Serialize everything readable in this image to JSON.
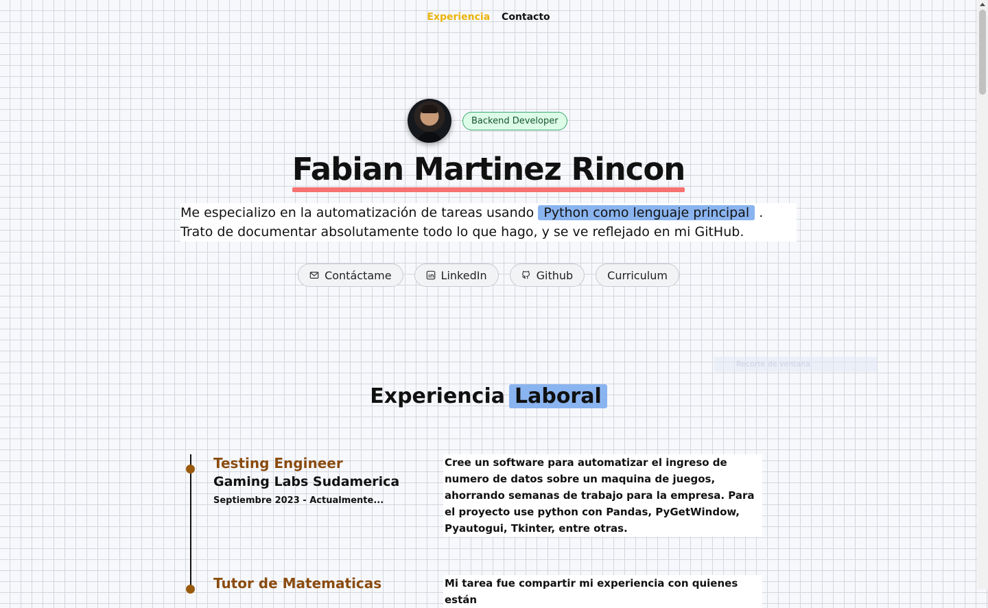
{
  "nav": {
    "items": [
      {
        "label": "Experiencia"
      },
      {
        "label": "Contacto"
      }
    ]
  },
  "hero": {
    "badge": "Backend Developer",
    "name": "Fabian Martinez Rincon",
    "intro_part1": "Me especializo en la automatización de tareas usando ",
    "intro_highlight": "Python como lenguaje principal",
    "intro_part2": " .",
    "intro_line2": "Trato de documentar absolutamente todo lo que hago, y se ve reflejado en mi GitHub."
  },
  "actions": [
    {
      "label": "Contáctame",
      "icon": "mail-icon"
    },
    {
      "label": "LinkedIn",
      "icon": "linkedin-icon"
    },
    {
      "label": "Github",
      "icon": "github-icon"
    },
    {
      "label": "Curriculum",
      "icon": ""
    }
  ],
  "overlay": {
    "ghost_text": "Recorte de ventana"
  },
  "experience": {
    "title": "Experiencia",
    "title_highlight": "Laboral",
    "jobs": [
      {
        "role": "Testing Engineer",
        "company": "Gaming Labs Sudamerica",
        "date": "Septiembre 2023 - Actualmente...",
        "description": "Cree un software para automatizar el ingreso de numero de datos sobre un maquina de juegos, ahorrando semanas de trabajo para la empresa. Para el proyecto use python con Pandas, PyGetWindow, Pyautogui, Tkinter, entre otras."
      },
      {
        "role": "Tutor de Matematicas",
        "description": "Mi tarea fue compartir mi experiencia con quienes están"
      }
    ]
  },
  "colors": {
    "accent": "#eab308",
    "highlight": "#8ab4f0",
    "underline": "#f87171",
    "badge_bg": "#dcfce7",
    "role": "#8a4b0f"
  }
}
